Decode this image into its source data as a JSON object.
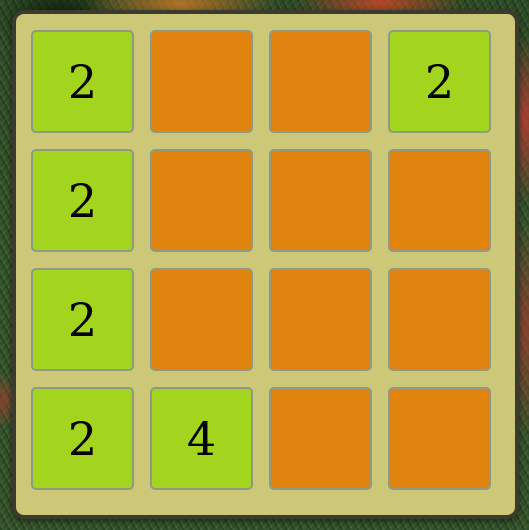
{
  "board": {
    "size": 4,
    "colors": {
      "board_background": "#ccc878",
      "board_border": "#3b3b30",
      "filled_tile": "#a3d51e",
      "empty_tile": "#e0840f",
      "tile_border": "#8e9a86"
    },
    "rows": [
      [
        "2",
        "",
        "",
        "2"
      ],
      [
        "2",
        "",
        "",
        ""
      ],
      [
        "2",
        "",
        "",
        ""
      ],
      [
        "2",
        "4",
        "",
        ""
      ]
    ]
  }
}
